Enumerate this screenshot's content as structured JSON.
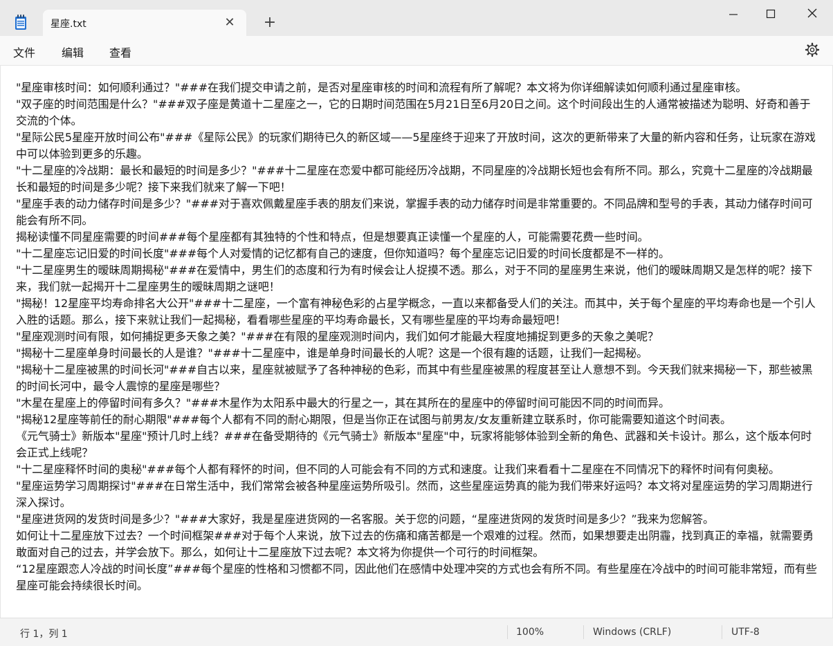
{
  "window": {
    "tab_title": "星座.txt",
    "tab_close_glyph": "✕",
    "new_tab_glyph": "+",
    "app_icon": "notepad-icon"
  },
  "menu": {
    "file": "文件",
    "edit": "编辑",
    "view": "查看"
  },
  "editor": {
    "lines": [
      "\"星座审核时间：如何顺利通过？\"###在我们提交申请之前，是否对星座审核的时间和流程有所了解呢？本文将为你详细解读如何顺利通过星座审核。",
      "\"双子座的时间范围是什么？\"###双子座是黄道十二星座之一，它的日期时间范围在5月21日至6月20日之间。这个时间段出生的人通常被描述为聪明、好奇和善于交流的个体。",
      "\"星际公民5星座开放时间公布\"###《星际公民》的玩家们期待已久的新区域——5星座终于迎来了开放时间，这次的更新带来了大量的新内容和任务，让玩家在游戏中可以体验到更多的乐趣。",
      "\"十二星座的冷战期：最长和最短的时间是多少？\"###十二星座在恋爱中都可能经历冷战期，不同星座的冷战期长短也会有所不同。那么，究竟十二星座的冷战期最长和最短的时间是多少呢？接下来我们就来了解一下吧！",
      "\"星座手表的动力储存时间是多少？\"###对于喜欢佩戴星座手表的朋友们来说，掌握手表的动力储存时间是非常重要的。不同品牌和型号的手表，其动力储存时间可能会有所不同。",
      "揭秘读懂不同星座需要的时间###每个星座都有其独特的个性和特点，但是想要真正读懂一个星座的人，可能需要花费一些时间。",
      "\"十二星座忘记旧爱的时间长度\"###每个人对爱情的记忆都有自己的速度，但你知道吗？每个星座忘记旧爱的时间长度都是不一样的。",
      "\"十二星座男生的暧昧周期揭秘\"###在爱情中，男生们的态度和行为有时候会让人捉摸不透。那么，对于不同的星座男生来说，他们的暧昧周期又是怎样的呢？接下来，我们就一起揭开十二星座男生的暧昧周期之谜吧！",
      "\"揭秘！12星座平均寿命排名大公开\"###十二星座，一个富有神秘色彩的占星学概念，一直以来都备受人们的关注。而其中，关于每个星座的平均寿命也是一个引人入胜的话题。那么，接下来就让我们一起揭秘，看看哪些星座的平均寿命最长，又有哪些星座的平均寿命最短吧！",
      "\"星座观测时间有限，如何捕捉更多天象之美？\"###在有限的星座观测时间内，我们如何才能最大程度地捕捉到更多的天象之美呢？",
      "\"揭秘十二星座单身时间最长的人是谁？\"###十二星座中，谁是单身时间最长的人呢？这是一个很有趣的话题，让我们一起揭秘。",
      "\"揭秘十二星座被黑的时间长河\"###自古以来，星座就被赋予了各种神秘的色彩，而其中有些星座被黑的程度甚至让人意想不到。今天我们就来揭秘一下，那些被黑的时间长河中，最令人震惊的星座是哪些？",
      "\"木星在星座上的停留时间有多久？\"###木星作为太阳系中最大的行星之一，其在其所在的星座中的停留时间可能因不同的时间而异。",
      "\"揭秘12星座等前任的耐心期限\"###每个人都有不同的耐心期限，但是当你正在试图与前男友/女友重新建立联系时，你可能需要知道这个时间表。",
      "《元气骑士》新版本\"星座\"预计几时上线？###在备受期待的《元气骑士》新版本\"星座\"中，玩家将能够体验到全新的角色、武器和关卡设计。那么，这个版本何时会正式上线呢？",
      "\"十二星座释怀时间的奥秘\"###每个人都有释怀的时间，但不同的人可能会有不同的方式和速度。让我们来看看十二星座在不同情况下的释怀时间有何奥秘。",
      "\"星座运势学习周期探讨\"###在日常生活中，我们常常会被各种星座运势所吸引。然而，这些星座运势真的能为我们带来好运吗？本文将对星座运势的学习周期进行深入探讨。",
      "\"星座进货网的发货时间是多少？\"###大家好，我是星座进货网的一名客服。关于您的问题，“星座进货网的发货时间是多少？”我来为您解答。",
      "如何让十二星座放下过去？一个时间框架###对于每个人来说，放下过去的伤痛和痛苦都是一个艰难的过程。然而，如果想要走出阴霾，找到真正的幸福，就需要勇敢面对自己的过去，并学会放下。那么，如何让十二星座放下过去呢？本文将为你提供一个可行的时间框架。",
      "“12星座跟恋人冷战的时间长度”###每个星座的性格和习惯都不同，因此他们在感情中处理冲突的方式也会有所不同。有些星座在冷战中的时间可能非常短，而有些星座可能会持续很长时间。"
    ]
  },
  "status": {
    "position": "行 1，列 1",
    "zoom": "100%",
    "line_ending": "Windows (CRLF)",
    "encoding": "UTF-8"
  }
}
